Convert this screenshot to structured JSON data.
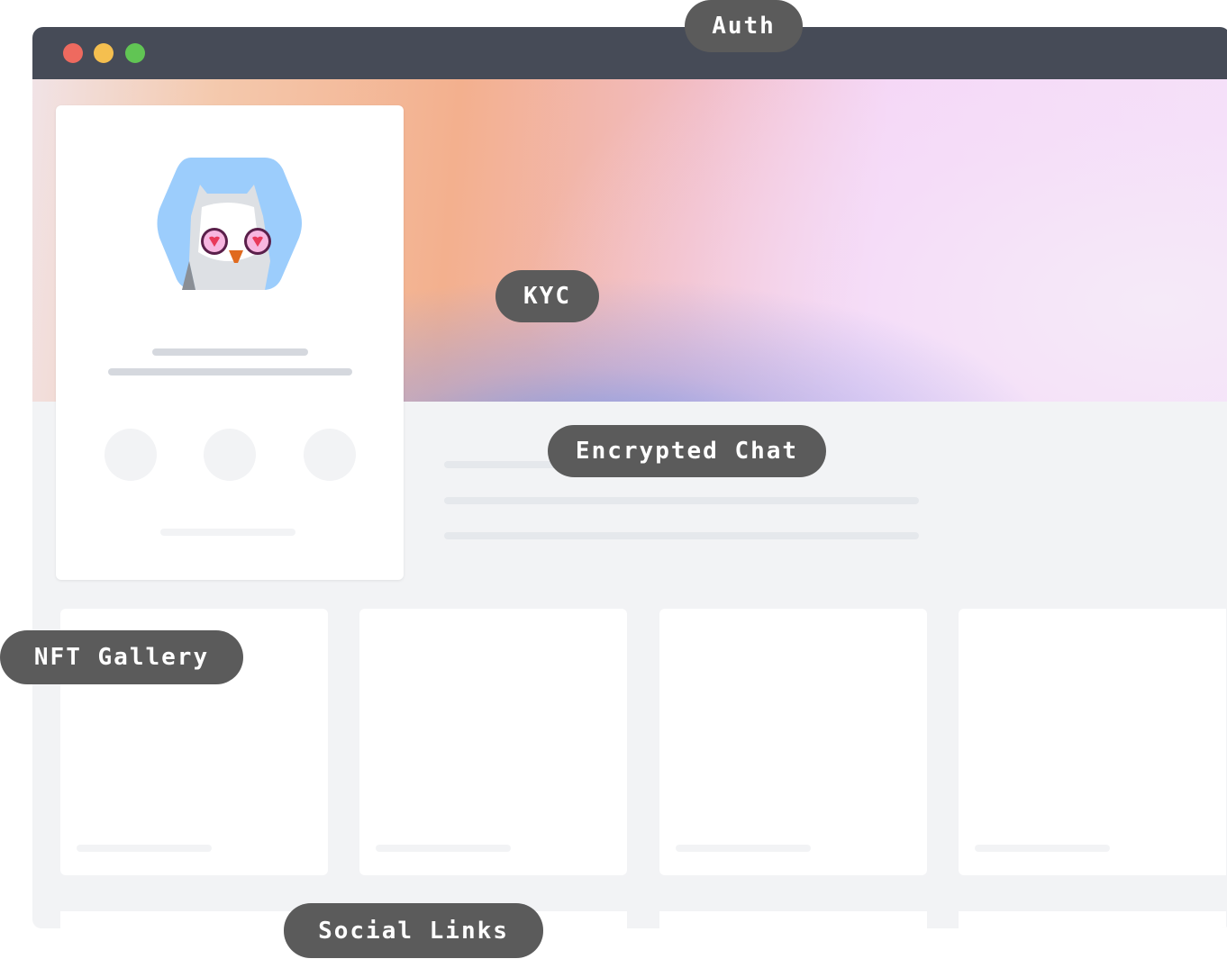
{
  "window": {
    "controls": [
      {
        "name": "close",
        "color": "#ee6a5f"
      },
      {
        "name": "minimize",
        "color": "#f5bf4f"
      },
      {
        "name": "maximize",
        "color": "#61c554"
      }
    ],
    "titlebar_color": "#464b57"
  },
  "labels": {
    "auth": "Auth",
    "kyc": "KYC",
    "encrypted_chat": "Encrypted Chat",
    "nft_gallery": "NFT Gallery",
    "social_links": "Social Links"
  },
  "profile": {
    "avatar": "pixel-owl-heart-eyes",
    "avatar_bg": "#9ccdfc"
  }
}
